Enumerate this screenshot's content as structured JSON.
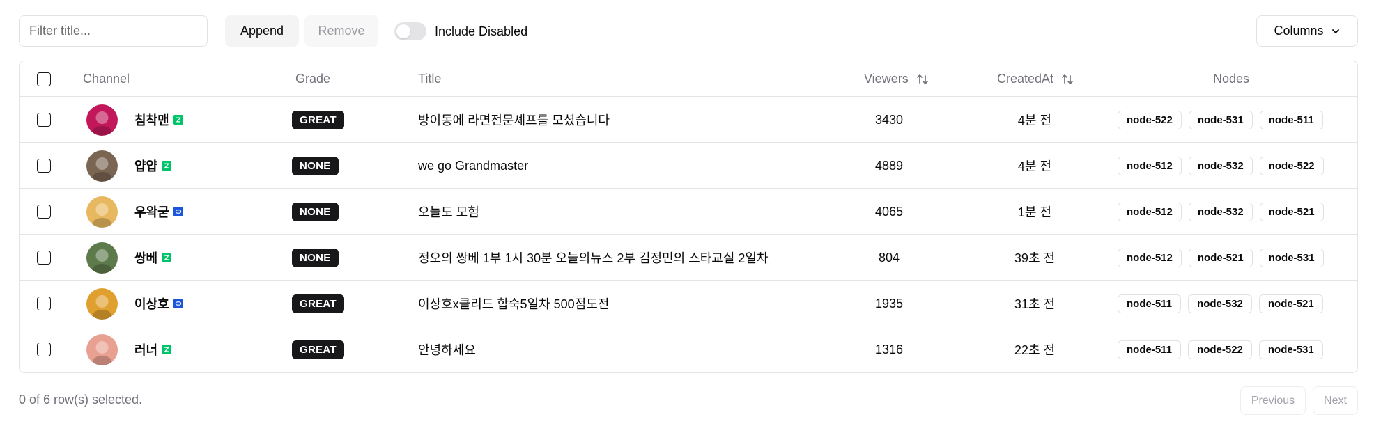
{
  "toolbar": {
    "filter_placeholder": "Filter title...",
    "filter_value": "",
    "append_label": "Append",
    "remove_label": "Remove",
    "include_disabled_label": "Include Disabled",
    "include_disabled_on": false,
    "columns_label": "Columns"
  },
  "table": {
    "headers": {
      "channel": "Channel",
      "grade": "Grade",
      "title": "Title",
      "viewers": "Viewers",
      "created_at": "CreatedAt",
      "nodes": "Nodes"
    },
    "rows": [
      {
        "channel": "침착맨",
        "platform": "chzzk",
        "grade": "GREAT",
        "title": "방이동에 라면전문셰프를 모셨습니다",
        "viewers": "3430",
        "created_at": "4분 전",
        "nodes": [
          "node-522",
          "node-531",
          "node-511"
        ],
        "avatar_color": "#c2185b"
      },
      {
        "channel": "얍얍",
        "platform": "chzzk",
        "grade": "NONE",
        "title": "we go Grandmaster",
        "viewers": "4889",
        "created_at": "4분 전",
        "nodes": [
          "node-512",
          "node-532",
          "node-522"
        ],
        "avatar_color": "#7a6552"
      },
      {
        "channel": "우왁굳",
        "platform": "soop",
        "grade": "NONE",
        "title": "오늘도 모험",
        "viewers": "4065",
        "created_at": "1분 전",
        "nodes": [
          "node-512",
          "node-532",
          "node-521"
        ],
        "avatar_color": "#e8b860"
      },
      {
        "channel": "쌍베",
        "platform": "chzzk",
        "grade": "NONE",
        "title": "정오의 쌍베 1부 1시 30분 오늘의뉴스 2부 김정민의 스타교실 2일차",
        "viewers": "804",
        "created_at": "39초 전",
        "nodes": [
          "node-512",
          "node-521",
          "node-531"
        ],
        "avatar_color": "#5d7a4a"
      },
      {
        "channel": "이상호",
        "platform": "soop",
        "grade": "GREAT",
        "title": "이상호x클리드 합숙5일차 500점도전",
        "viewers": "1935",
        "created_at": "31초 전",
        "nodes": [
          "node-511",
          "node-532",
          "node-521"
        ],
        "avatar_color": "#e0a030"
      },
      {
        "channel": "러너",
        "platform": "chzzk",
        "grade": "GREAT",
        "title": "안녕하세요",
        "viewers": "1316",
        "created_at": "22초 전",
        "nodes": [
          "node-511",
          "node-522",
          "node-531"
        ],
        "avatar_color": "#e8a090"
      }
    ]
  },
  "footer": {
    "selection_text": "0 of 6 row(s) selected.",
    "previous_label": "Previous",
    "next_label": "Next"
  },
  "colors": {
    "chzzk": "#00c46a",
    "soop": "#1a56db",
    "badge_bg": "#18181b",
    "border": "#e4e4e7"
  },
  "icons": {
    "columns_button": "chevron-down-icon",
    "sort": "sort-arrows-icon",
    "platform_chzzk": "chzzk-logo-icon",
    "platform_soop": "soop-logo-icon"
  }
}
